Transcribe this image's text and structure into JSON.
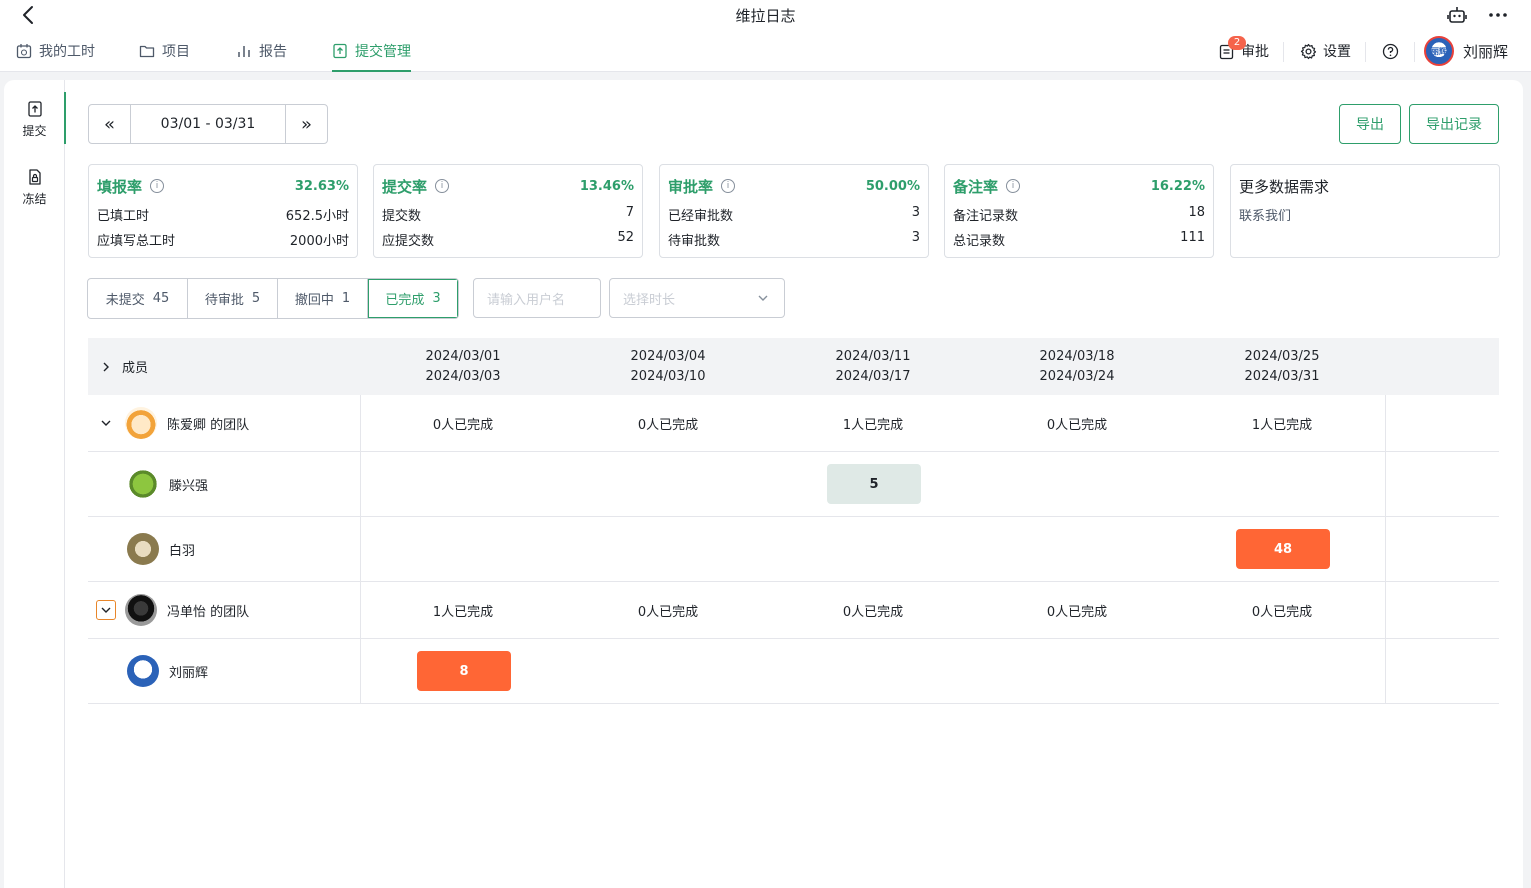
{
  "window": {
    "title": "维拉日志"
  },
  "nav": {
    "items": [
      {
        "label": "我的工时",
        "icon": "calendar-icon"
      },
      {
        "label": "项目",
        "icon": "folder-icon"
      },
      {
        "label": "报告",
        "icon": "bar-chart-icon"
      },
      {
        "label": "提交管理",
        "icon": "upload-doc-icon",
        "active": true
      }
    ],
    "approval": {
      "label": "审批",
      "badge": "2"
    },
    "settings": {
      "label": "设置"
    },
    "user": {
      "name": "刘丽辉",
      "avatar_text": "丽辉"
    }
  },
  "sidebar": {
    "items": [
      {
        "label": "提交",
        "active": true
      },
      {
        "label": "冻结"
      }
    ]
  },
  "date_range": {
    "value": "03/01 - 03/31",
    "prev": "«",
    "next": "»"
  },
  "actions": {
    "export": "导出",
    "export_log": "导出记录"
  },
  "stats": [
    {
      "title": "填报率",
      "percent": "32.63%",
      "rows": [
        {
          "label": "已填工时",
          "value": "652.5小时"
        },
        {
          "label": "应填写总工时",
          "value": "2000小时"
        }
      ]
    },
    {
      "title": "提交率",
      "percent": "13.46%",
      "rows": [
        {
          "label": "提交数",
          "value": "7"
        },
        {
          "label": "应提交数",
          "value": "52"
        }
      ]
    },
    {
      "title": "审批率",
      "percent": "50.00%",
      "rows": [
        {
          "label": "已经审批数",
          "value": "3"
        },
        {
          "label": "待审批数",
          "value": "3"
        }
      ]
    },
    {
      "title": "备注率",
      "percent": "16.22%",
      "rows": [
        {
          "label": "备注记录数",
          "value": "18"
        },
        {
          "label": "总记录数",
          "value": "111"
        }
      ]
    }
  ],
  "more_card": {
    "title": "更多数据需求",
    "link": "联系我们"
  },
  "filters": [
    {
      "label": "未提交",
      "count": "45"
    },
    {
      "label": "待审批",
      "count": "5"
    },
    {
      "label": "撤回中",
      "count": "1"
    },
    {
      "label": "已完成",
      "count": "3",
      "active": true
    }
  ],
  "search": {
    "placeholder": "请输入用户名"
  },
  "duration_select": {
    "placeholder": "选择时长"
  },
  "table": {
    "member_header": "成员",
    "weeks": [
      {
        "start": "2024/03/01",
        "end": "2024/03/03"
      },
      {
        "start": "2024/03/04",
        "end": "2024/03/10"
      },
      {
        "start": "2024/03/11",
        "end": "2024/03/17"
      },
      {
        "start": "2024/03/18",
        "end": "2024/03/24"
      },
      {
        "start": "2024/03/25",
        "end": "2024/03/31"
      }
    ],
    "teams": [
      {
        "name": "陈爱卿 的团队",
        "summary": [
          "0人已完成",
          "0人已完成",
          "1人已完成",
          "0人已完成",
          "1人已完成"
        ],
        "members": [
          {
            "name": "滕兴强",
            "cells": {
              "2": "5"
            }
          },
          {
            "name": "白羽",
            "cells": {
              "4": "48"
            }
          }
        ]
      },
      {
        "name": "冯单怡 的团队",
        "summary": [
          "1人已完成",
          "0人已完成",
          "0人已完成",
          "0人已完成",
          "0人已完成"
        ],
        "members": [
          {
            "name": "刘丽辉",
            "cells": {
              "0": "8"
            }
          }
        ]
      }
    ]
  },
  "colors": {
    "accent": "#2e9e6b",
    "hours_high": "#ff6635",
    "hours_normal": "#dfe9e6",
    "badge": "#f5634b"
  }
}
